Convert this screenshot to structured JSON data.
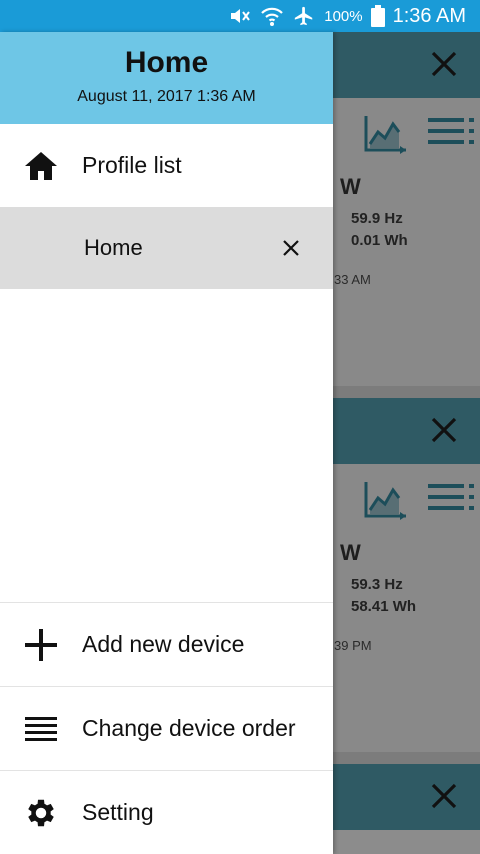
{
  "status_bar": {
    "battery": "100%",
    "time": "1:36 AM"
  },
  "drawer": {
    "title": "Home",
    "date": "August 11, 2017 1:36 AM",
    "profile_list_label": "Profile list",
    "profiles": [
      {
        "name": "Home"
      }
    ],
    "menu": {
      "add_device": "Add new device",
      "change_order": "Change device order",
      "setting": "Setting"
    }
  },
  "background_cards": [
    {
      "power_unit": "W",
      "frequency": "59.9 Hz",
      "energy": "0.01 Wh",
      "time_fragment": "33 AM"
    },
    {
      "power_unit": "W",
      "frequency": "59.3 Hz",
      "energy": "58.41 Wh",
      "time_fragment": "39 PM"
    }
  ],
  "colors": {
    "status_bar": "#1a9bd7",
    "drawer_header": "#6ec6e6",
    "card_header": "#2f5a64",
    "selected_row": "#dcdcdc"
  }
}
